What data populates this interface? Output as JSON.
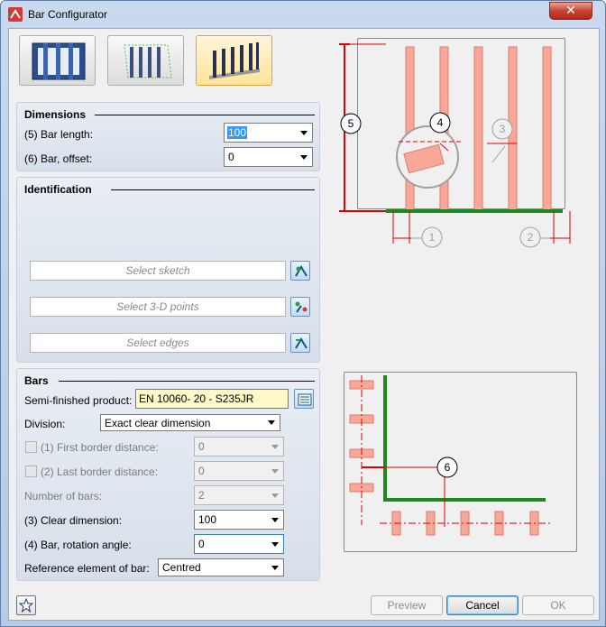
{
  "window": {
    "title": "Bar Configurator",
    "close_symbol": "✕"
  },
  "dimensions": {
    "title": "Dimensions",
    "bar_length_label": "(5) Bar length:",
    "bar_length_value": "100",
    "bar_offset_label": "(6) Bar, offset:",
    "bar_offset_value": "0"
  },
  "identification": {
    "title": "Identification",
    "select_sketch": "Select sketch",
    "select_points": "Select 3-D points",
    "select_edges": "Select edges"
  },
  "bars": {
    "title": "Bars",
    "semi_finished_label": "Semi-finished product:",
    "semi_finished_value": "EN 10060- 20 - S235JR",
    "division_label": "Division:",
    "division_value": "Exact clear dimension",
    "first_border_label": "(1) First border distance:",
    "first_border_value": "0",
    "last_border_label": "(2) Last border distance:",
    "last_border_value": "0",
    "number_label": "Number of bars:",
    "number_value": "2",
    "clear_label": "(3) Clear dimension:",
    "clear_value": "100",
    "rotation_label": "(4) Bar, rotation angle:",
    "rotation_value": "0",
    "reference_label": "Reference element of bar:",
    "reference_value": "Centred"
  },
  "diagram_top": {
    "label_5": "5",
    "label_4": "4",
    "label_3": "3",
    "label_1": "1",
    "label_2": "2"
  },
  "diagram_bottom": {
    "label_6": "6"
  },
  "buttons": {
    "preview": "Preview",
    "cancel": "Cancel",
    "ok": "OK"
  },
  "colors": {
    "bar_fill": "#f8a899",
    "base_line": "#1e8a1e",
    "dimension": "#e00000"
  }
}
